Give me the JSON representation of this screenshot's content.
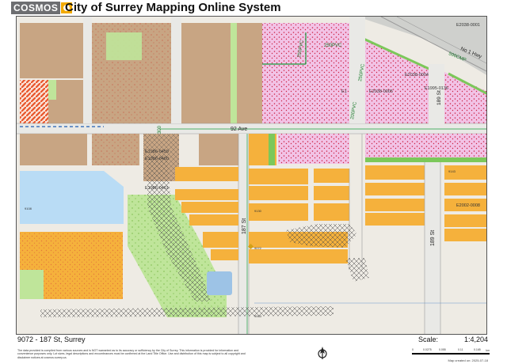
{
  "header": {
    "logo_text": "COSMOS",
    "title": "City of Surrey Mapping Online System"
  },
  "map": {
    "street_labels": {
      "ave_92": "92 Ave",
      "st_187": "187 St",
      "st_189": "189 St",
      "st_189_upper": "189 St",
      "hwy_1": "No 1 Hwy"
    },
    "annotations": {
      "e2038_0001": "E2038-0001",
      "e2038_0005": "E2038-0005",
      "e1995_0136": "E1995-0136",
      "e2038_0004": "E2038-0004",
      "e1986_0459": "E1986-0459",
      "e1986_0460": "E1986-0460",
      "e1986_0461": "E1986-0461",
      "e2002_0008": "E2002-0008",
      "e1": "E1",
      "pvc_250_a": "250PVC",
      "pvc_250_b": "250PVC",
      "pvc_250_c": "250PVC",
      "pvc_200": "200PVC",
      "cmp_500": "500CMP",
      "fm_300": "300"
    },
    "parcel_numbers": {
      "p9072": "9072",
      "p9108": "9108",
      "p9130": "9130",
      "p9143": "9143",
      "p9063": "9063"
    },
    "colors": {
      "residential_orange": "#f5b13c",
      "multifamily_pink": "#f2c3e6",
      "agricultural_tan": "#c8a583",
      "park_green": "#bfe59a",
      "water_blue": "#b9dcf5",
      "road_grey": "#e9e9e6",
      "highway_grey": "#cfd0cd",
      "hatched_red": "#e8552a"
    }
  },
  "footer": {
    "address": "9072 - 187 St, Surrey",
    "scale_label": "Scale:",
    "scale_value": "1:4,204",
    "disclaimer": "The data provided is compiled from various sources and is NOT warranted as to its accuracy or sufficiency by the City of Surrey. This information is provided for information and convenience purposes only. Lot sizes, legal descriptions and encumbrances must be confirmed at the Land Title Office. Use and distribution of this map is subject to all copyright and disclaimer notices at cosmos.surrey.ca.",
    "scalebar_ticks": [
      "0",
      "0.0275",
      "0.055",
      "0.11",
      "0.165"
    ],
    "scalebar_units": "km",
    "created": "Map created on: 2025-07-18"
  }
}
